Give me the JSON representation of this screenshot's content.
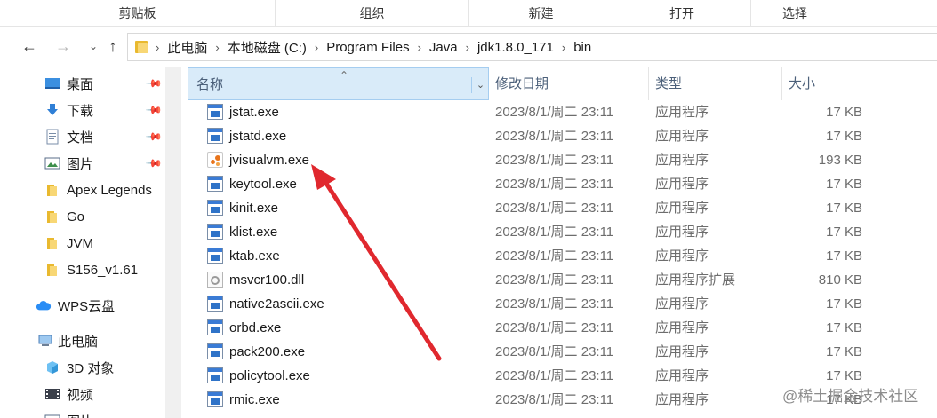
{
  "ribbon": {
    "groups": [
      "剪贴板",
      "组织",
      "新建",
      "打开",
      "选择"
    ]
  },
  "address": {
    "back_icon": "arrow-left-icon",
    "forward_icon": "arrow-right-icon",
    "up_icon": "arrow-up-icon",
    "crumbs": [
      "此电脑",
      "本地磁盘 (C:)",
      "Program Files",
      "Java",
      "jdk1.8.0_171",
      "bin"
    ]
  },
  "nav": {
    "items": [
      {
        "label": "桌面",
        "icon": "desktop-icon",
        "pinned": true
      },
      {
        "label": "下载",
        "icon": "download-icon",
        "pinned": true
      },
      {
        "label": "文档",
        "icon": "document-icon",
        "pinned": true
      },
      {
        "label": "图片",
        "icon": "picture-icon",
        "pinned": true
      },
      {
        "label": "Apex Legends",
        "icon": "folder-icon",
        "pinned": false
      },
      {
        "label": "Go",
        "icon": "folder-icon",
        "pinned": false
      },
      {
        "label": "JVM",
        "icon": "folder-icon",
        "pinned": false
      },
      {
        "label": "S156_v1.61",
        "icon": "folder-icon",
        "pinned": false
      },
      {
        "label": "WPS云盘",
        "icon": "cloud-icon",
        "pinned": false
      },
      {
        "label": "此电脑",
        "icon": "computer-icon",
        "pinned": false
      },
      {
        "label": "3D 对象",
        "icon": "3d-objects-icon",
        "pinned": false
      },
      {
        "label": "视频",
        "icon": "video-icon",
        "pinned": false
      },
      {
        "label": "图片",
        "icon": "picture-icon",
        "pinned": false
      }
    ]
  },
  "columns": {
    "name": "名称",
    "date": "修改日期",
    "type": "类型",
    "size": "大小"
  },
  "files": [
    {
      "name": "jstat.exe",
      "date": "2023/8/1/周二 23:11",
      "type": "应用程序",
      "size": "17 KB",
      "icon": "exe-icon"
    },
    {
      "name": "jstatd.exe",
      "date": "2023/8/1/周二 23:11",
      "type": "应用程序",
      "size": "17 KB",
      "icon": "exe-icon"
    },
    {
      "name": "jvisualvm.exe",
      "date": "2023/8/1/周二 23:11",
      "type": "应用程序",
      "size": "193 KB",
      "icon": "jvisualvm-icon"
    },
    {
      "name": "keytool.exe",
      "date": "2023/8/1/周二 23:11",
      "type": "应用程序",
      "size": "17 KB",
      "icon": "exe-icon"
    },
    {
      "name": "kinit.exe",
      "date": "2023/8/1/周二 23:11",
      "type": "应用程序",
      "size": "17 KB",
      "icon": "exe-icon"
    },
    {
      "name": "klist.exe",
      "date": "2023/8/1/周二 23:11",
      "type": "应用程序",
      "size": "17 KB",
      "icon": "exe-icon"
    },
    {
      "name": "ktab.exe",
      "date": "2023/8/1/周二 23:11",
      "type": "应用程序",
      "size": "17 KB",
      "icon": "exe-icon"
    },
    {
      "name": "msvcr100.dll",
      "date": "2023/8/1/周二 23:11",
      "type": "应用程序扩展",
      "size": "810 KB",
      "icon": "dll-icon"
    },
    {
      "name": "native2ascii.exe",
      "date": "2023/8/1/周二 23:11",
      "type": "应用程序",
      "size": "17 KB",
      "icon": "exe-icon"
    },
    {
      "name": "orbd.exe",
      "date": "2023/8/1/周二 23:11",
      "type": "应用程序",
      "size": "17 KB",
      "icon": "exe-icon"
    },
    {
      "name": "pack200.exe",
      "date": "2023/8/1/周二 23:11",
      "type": "应用程序",
      "size": "17 KB",
      "icon": "exe-icon"
    },
    {
      "name": "policytool.exe",
      "date": "2023/8/1/周二 23:11",
      "type": "应用程序",
      "size": "17 KB",
      "icon": "exe-icon"
    },
    {
      "name": "rmic.exe",
      "date": "2023/8/1/周二 23:11",
      "type": "应用程序",
      "size": "17 KB",
      "icon": "exe-icon"
    }
  ],
  "annotation": {
    "arrow_color": "#e0282e",
    "target": "jvisualvm.exe"
  },
  "watermark": "@稀土掘金技术社区"
}
